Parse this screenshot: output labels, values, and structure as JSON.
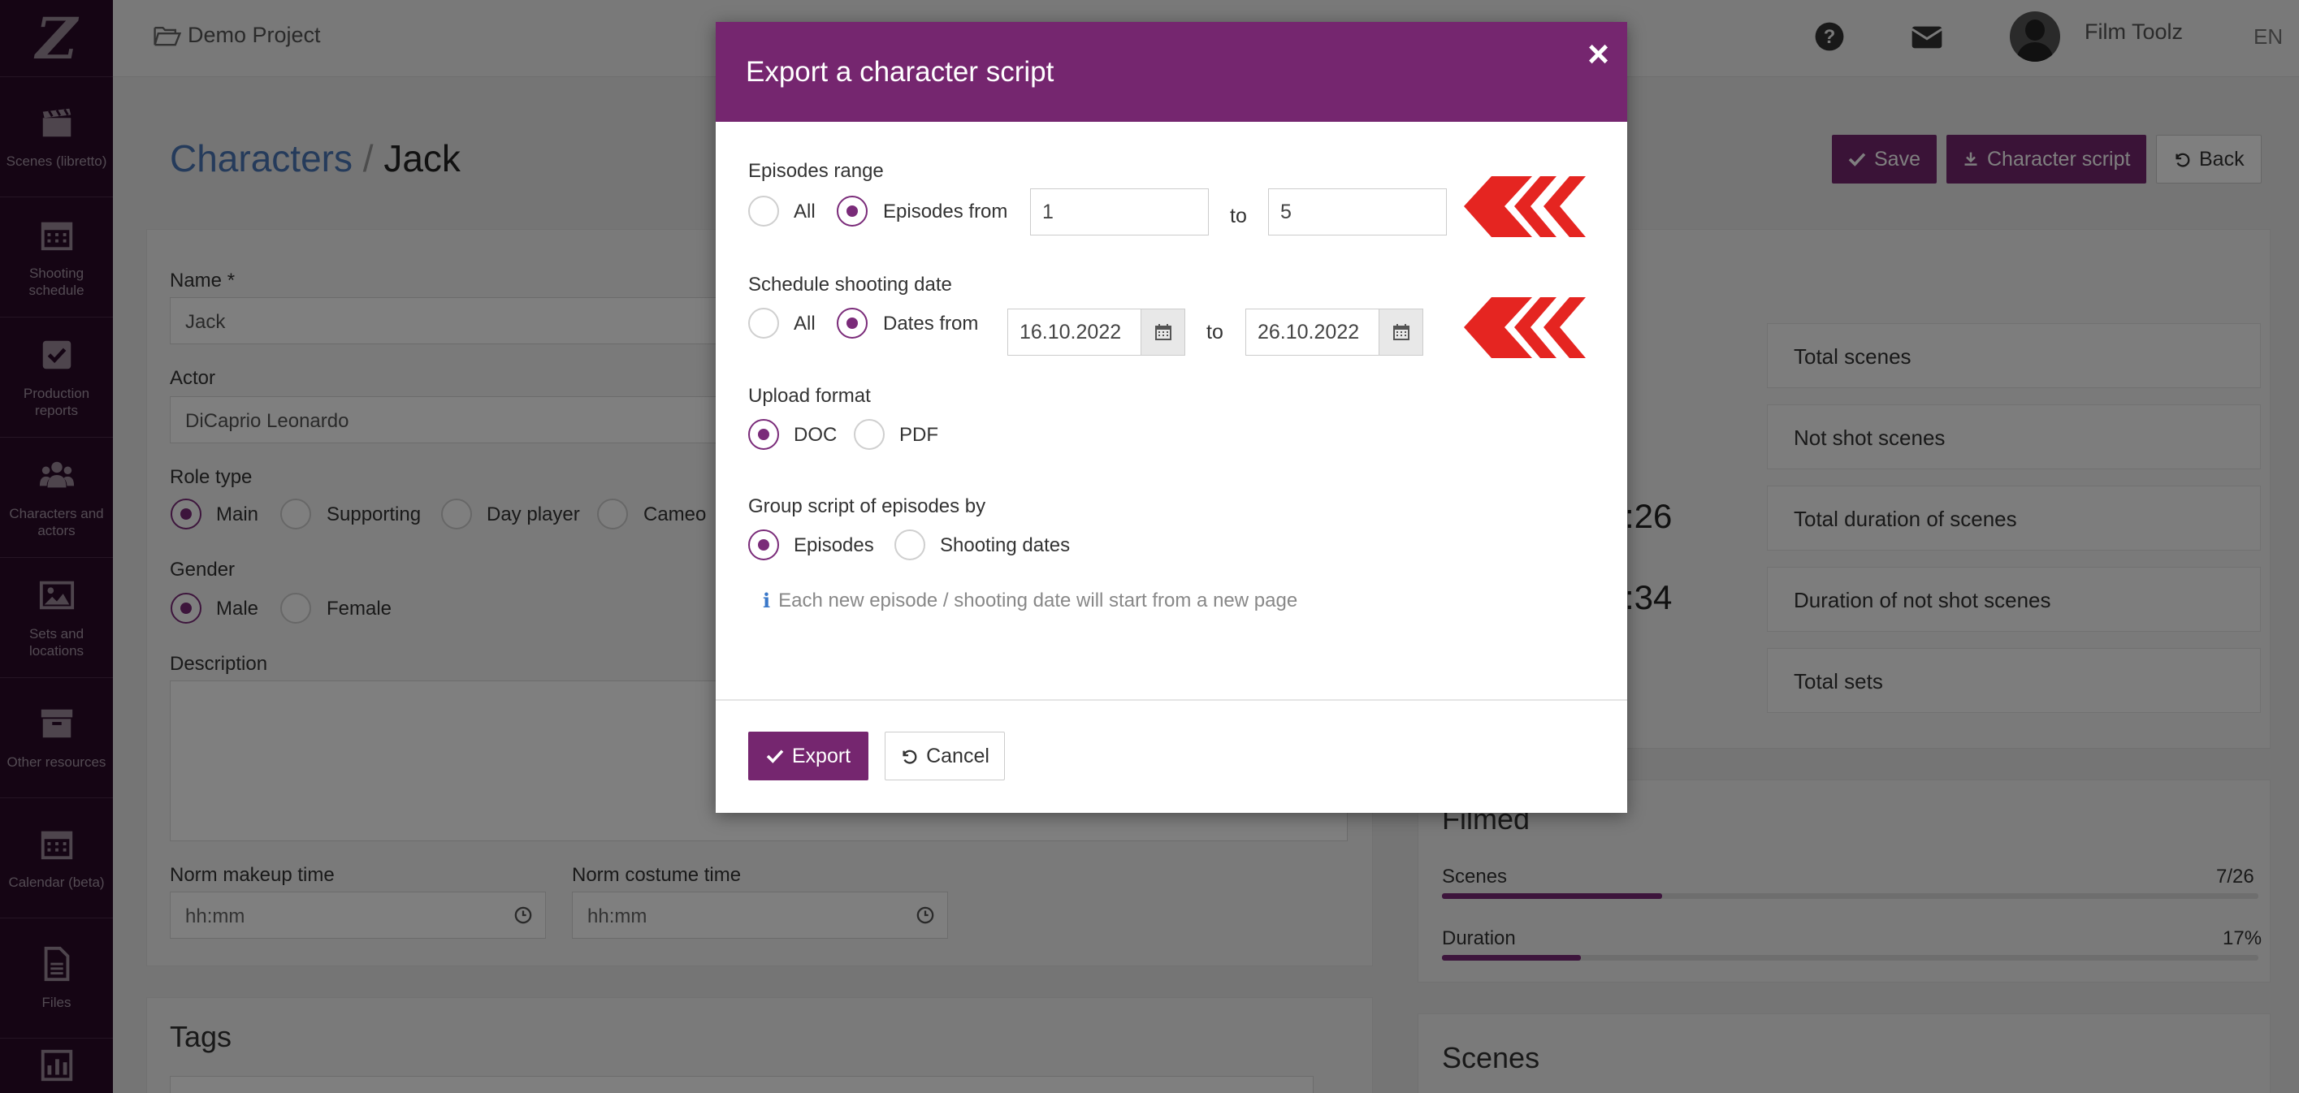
{
  "sidebar": {
    "logo": "Z",
    "items": [
      {
        "label": "Scenes (libretto)",
        "icon": "clapperboard-icon"
      },
      {
        "label": "Shooting schedule",
        "icon": "calendar-icon"
      },
      {
        "label": "Production reports",
        "icon": "checkbox-icon"
      },
      {
        "label": "Characters and actors",
        "icon": "users-icon"
      },
      {
        "label": "Sets and locations",
        "icon": "image-icon"
      },
      {
        "label": "Other resources",
        "icon": "archive-icon"
      },
      {
        "label": "Calendar (beta)",
        "icon": "calendar-grid-icon"
      },
      {
        "label": "Files",
        "icon": "file-icon"
      },
      {
        "label": "",
        "icon": "bar-chart-icon"
      }
    ]
  },
  "topbar": {
    "project": "Demo Project",
    "user_name": "Film Toolz",
    "language": "EN"
  },
  "page": {
    "breadcrumb_parent": "Characters",
    "breadcrumb_sep": "/",
    "breadcrumb_current": "Jack",
    "buttons": {
      "save": "Save",
      "character_script": "Character script",
      "back": "Back"
    },
    "form": {
      "name_label": "Name *",
      "name_value": "Jack",
      "actor_label": "Actor",
      "actor_value": "DiCaprio Leonardo",
      "role_type_label": "Role type",
      "role_types": [
        "Main",
        "Supporting",
        "Day player",
        "Cameo"
      ],
      "gender_label": "Gender",
      "genders": [
        "Male",
        "Female"
      ],
      "description_label": "Description",
      "makeup_label": "Norm makeup time",
      "makeup_placeholder": "hh:mm",
      "costume_label": "Norm costume time",
      "costume_placeholder": "hh:mm",
      "tags_title": "Tags"
    },
    "stats": {
      "rows": [
        "Total scenes",
        "Not shot scenes",
        "Total duration of scenes",
        "Duration of not shot scenes",
        "Total sets"
      ],
      "big1": ":26",
      "big2": ":34"
    },
    "filmed": {
      "title": "Filmed",
      "scenes_label": "Scenes",
      "scenes_value": "7/26",
      "scenes_fraction": 0.27,
      "duration_label": "Duration",
      "duration_value": "17%",
      "duration_fraction": 0.17
    },
    "scenes_title": "Scenes"
  },
  "modal": {
    "title": "Export a character script",
    "close": "×",
    "episodes_range": {
      "label": "Episodes range",
      "opt_all": "All",
      "opt_from": "Episodes from",
      "from_value": "1",
      "to_label": "to",
      "to_value": "5",
      "selected": "from"
    },
    "schedule": {
      "label": "Schedule shooting date",
      "opt_all": "All",
      "opt_from": "Dates from",
      "from_value": "16.10.2022",
      "to_label": "to",
      "to_value": "26.10.2022",
      "selected": "from"
    },
    "upload_format": {
      "label": "Upload format",
      "opt_doc": "DOC",
      "opt_pdf": "PDF",
      "selected": "DOC"
    },
    "group_by": {
      "label": "Group script of episodes by",
      "opt_episodes": "Episodes",
      "opt_dates": "Shooting dates",
      "selected": "Episodes"
    },
    "info": "Each new episode / shooting date will start from a new page",
    "export_button": "Export",
    "cancel_button": "Cancel"
  },
  "colors": {
    "brand": "#75266f",
    "sidebar": "#2a0a29",
    "accent_arrow": "#e52521",
    "link": "#4a76b6"
  }
}
